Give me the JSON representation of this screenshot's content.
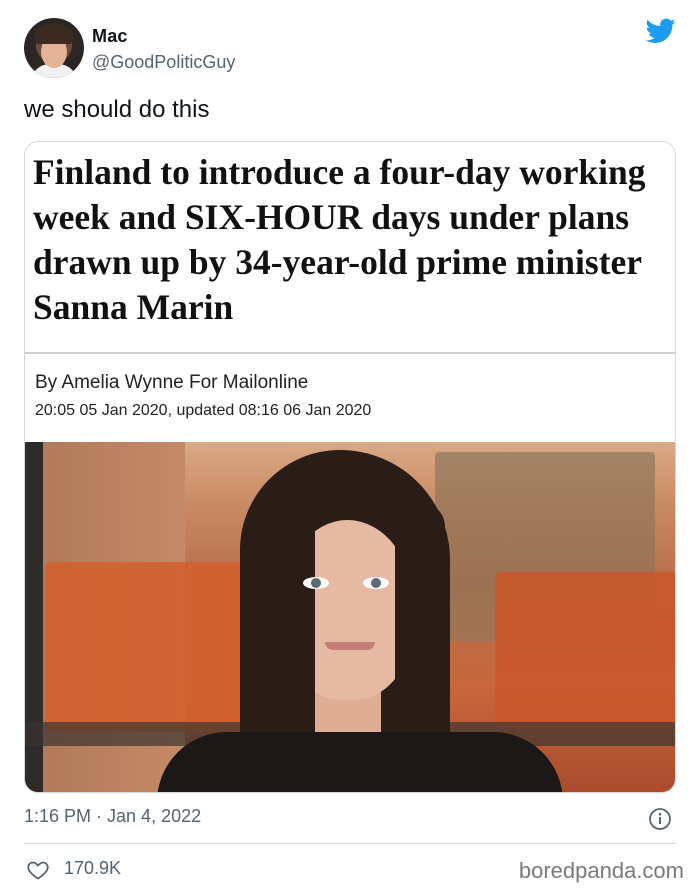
{
  "author": {
    "name": "Mac",
    "handle": "@GoodPoliticGuy"
  },
  "tweet": {
    "text": "we should do this",
    "timestamp": "1:16 PM · Jan 4, 2022",
    "likes": "170.9K"
  },
  "article": {
    "headline": "Finland to introduce a four-day working week and SIX-HOUR days under plans drawn up by 34-year-old prime minister Sanna Marin",
    "byline": "By Amelia Wynne For Mailonline",
    "dates": "20:05 05 Jan 2020, updated 08:16 06 Jan 2020"
  },
  "watermark": "boredpanda.com",
  "icons": {
    "brand": "twitter-bird-icon",
    "info": "info-icon",
    "like": "heart-icon"
  },
  "colors": {
    "twitter_blue": "#1d9bf0",
    "secondary_text": "#536471",
    "border": "#cfd9de"
  }
}
